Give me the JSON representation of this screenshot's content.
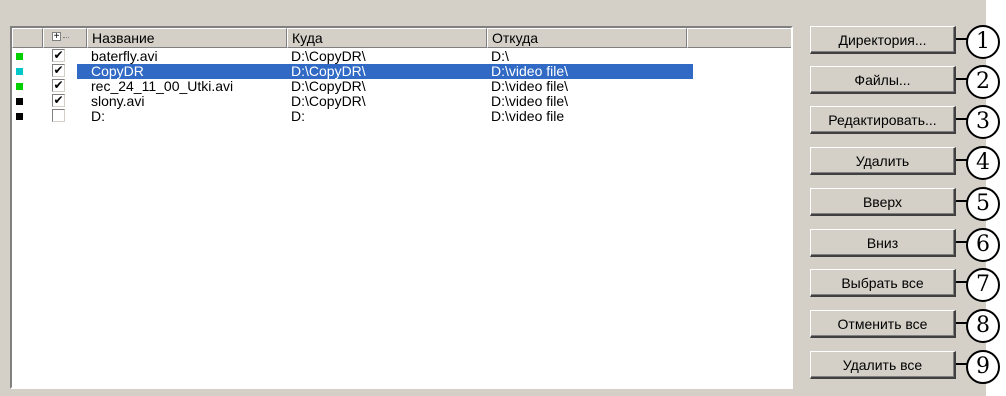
{
  "columns": {
    "name": "Название",
    "dest": "Куда",
    "src": "Откуда"
  },
  "rows": [
    {
      "marker_color": "#00d000",
      "checked": "✔",
      "name": "baterfly.avi",
      "dest": "D:\\CopyDR\\",
      "src": "D:\\"
    },
    {
      "marker_color": "#00c8c8",
      "checked": "✔",
      "name": "CopyDR",
      "dest": "D:\\CopyDR\\",
      "src": "D:\\video file\\"
    },
    {
      "marker_color": "#00d000",
      "checked": "✔",
      "name": "rec_24_11_00_Utki.avi",
      "dest": "D:\\CopyDR\\",
      "src": "D:\\video file\\"
    },
    {
      "marker_color": "#000000",
      "checked": "✔",
      "name": "slony.avi",
      "dest": "D:\\CopyDR\\",
      "src": "D:\\video file\\"
    },
    {
      "marker_color": "#000000",
      "checked": "",
      "name": "D:",
      "dest": "D:",
      "src": "D:\\video file"
    }
  ],
  "buttons": {
    "directory": "Директория...",
    "files": "Файлы...",
    "edit": "Редактировать...",
    "delete": "Удалить",
    "up": "Вверх",
    "down": "Вниз",
    "select_all": "Выбрать все",
    "deselect_all": "Отменить все",
    "delete_all": "Удалить все"
  },
  "callouts": [
    "1",
    "2",
    "3",
    "4",
    "5",
    "6",
    "7",
    "8",
    "9"
  ],
  "selection_color": "#316ac5"
}
